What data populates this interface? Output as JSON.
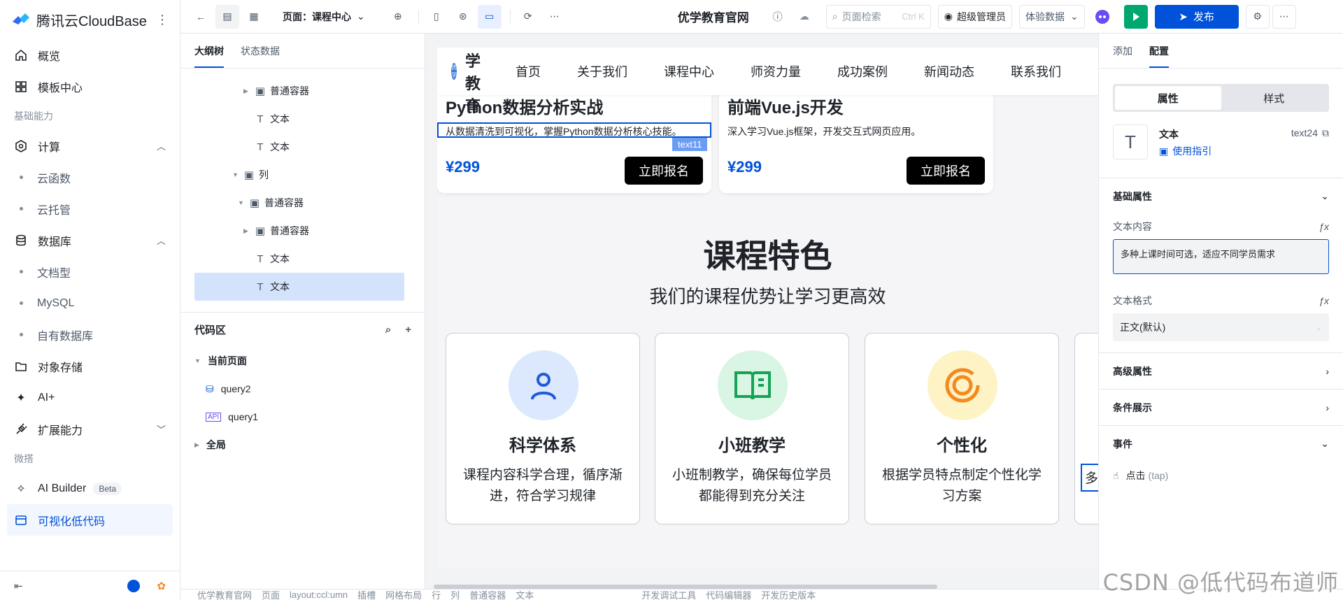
{
  "nav": {
    "brand": "腾讯云CloudBase",
    "items": [
      {
        "label": "概览"
      },
      {
        "label": "模板中心"
      }
    ],
    "group_basic": "基础能力",
    "compute": "计算",
    "compute_sub": [
      "云函数",
      "云托管"
    ],
    "database": "数据库",
    "database_sub": [
      "文档型",
      "MySQL",
      "自有数据库"
    ],
    "storage": "对象存储",
    "ai": "AI+",
    "extend": "扩展能力",
    "group_micro": "微搭",
    "ai_builder": "AI Builder",
    "beta": "Beta",
    "lowcode": "可视化低代码"
  },
  "topbar": {
    "page_label": "页面：课程中心",
    "app_title": "优学教育官网",
    "search_placeholder": "页面检索",
    "search_kbd": "Ctrl K",
    "user": "超级管理员",
    "data_mode": "体验数据",
    "publish": "发布"
  },
  "outline": {
    "tabs": [
      "大纲树",
      "状态数据"
    ],
    "tree": [
      {
        "label": "普通容器"
      },
      {
        "label": "文本"
      },
      {
        "label": "文本"
      },
      {
        "label": "列"
      },
      {
        "label": "普通容器"
      },
      {
        "label": "普通容器"
      },
      {
        "label": "文本"
      },
      {
        "label": "文本"
      }
    ],
    "code_title": "代码区",
    "current_page": "当前页面",
    "queries": [
      "query2",
      "query1"
    ],
    "global": "全局"
  },
  "canvas": {
    "site_name": "优学教育",
    "logo_text": "优学",
    "nav_links": [
      "首页",
      "关于我们",
      "课程中心",
      "师资力量",
      "成功案例",
      "新闻动态",
      "联系我们"
    ],
    "courses": [
      {
        "title": "Python数据分析实战",
        "desc": "从数据清洗到可视化，掌握Python数据分析核心技能。",
        "price": "¥299",
        "btn": "立即报名"
      },
      {
        "title": "前端Vue.js开发",
        "desc": "深入学习Vue.js框架，开发交互式网页应用。",
        "price": "¥299",
        "btn": "立即报名"
      }
    ],
    "selection_tag": "text11",
    "features_title": "课程特色",
    "features_sub": "我们的课程优势让学习更高效",
    "features": [
      {
        "title": "科学体系",
        "desc": "课程内容科学合理，循序渐进，符合学习规律",
        "color": "#dce8fd",
        "icon_color": "#1e5bd8"
      },
      {
        "title": "小班教学",
        "desc": "小班制教学，确保每位学员都能得到充分关注",
        "color": "#d9f5e4",
        "icon_color": "#13a456"
      },
      {
        "title": "个性化",
        "desc": "根据学员特点制定个性化学习方案",
        "color": "#fdf3c4",
        "icon_color": "#f48a1f"
      },
      {
        "title": "",
        "desc": "多"
      }
    ]
  },
  "props": {
    "tabs": [
      "添加",
      "配置"
    ],
    "seg": [
      "属性",
      "样式"
    ],
    "comp_name": "文本",
    "comp_guide": "使用指引",
    "comp_id": "text24",
    "basic": "基础属性",
    "text_content_label": "文本内容",
    "text_content": "多种上课时间可选，适应不同学员需求",
    "text_format_label": "文本格式",
    "text_format": "正文(默认)",
    "advanced": "高级属性",
    "condition": "条件展示",
    "events": "事件",
    "event_tap": "点击",
    "event_tap_code": "(tap)"
  },
  "bottombar": {
    "crumbs": [
      "优学教育官网",
      "页面",
      "layout:ccl:umn",
      "插槽",
      "网格布局",
      "行",
      "列",
      "普通容器",
      "文本"
    ],
    "tools": [
      "开发调试工具",
      "代码编辑器",
      "开发历史版本"
    ]
  },
  "watermark": "CSDN @低代码布道师"
}
